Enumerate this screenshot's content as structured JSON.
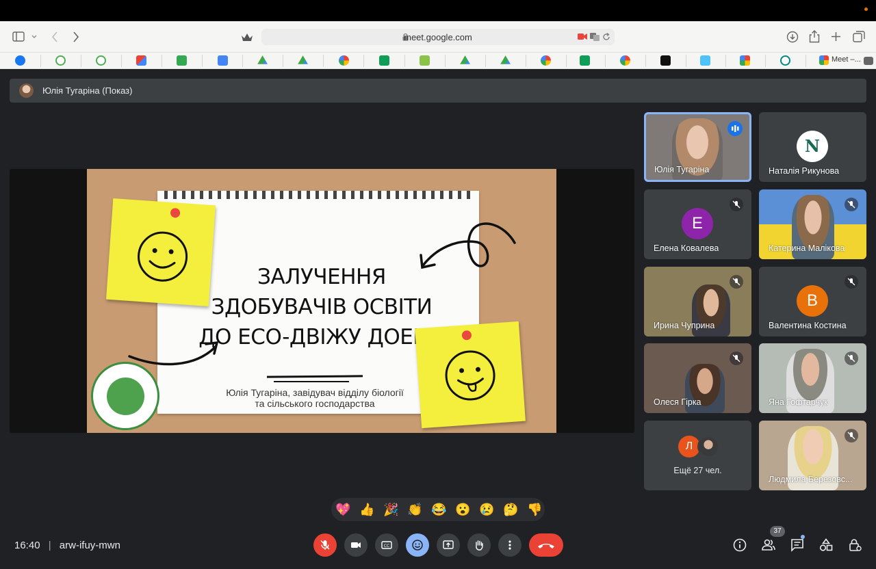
{
  "browser": {
    "url": "meet.google.com",
    "last_tab_label": "Meet –..."
  },
  "presenter_bar": {
    "label": "Юлія Тугаріна (Показ)"
  },
  "slide": {
    "title_lines": [
      "ЗАЛУЧЕННЯ",
      "ЗДОБУВАЧІВ ОСВІТИ",
      "ДО ECO-ДВІЖУ ДОЕНЦ"
    ],
    "subtitle_lines": [
      "Юлія Тугаріна, завідувач відділу біології",
      "та сільського господарства"
    ]
  },
  "participants": [
    {
      "name": "Юлія Тугаріна",
      "type": "video",
      "speaking": true
    },
    {
      "name": "Наталія Рикунова",
      "type": "logo",
      "initial": "N"
    },
    {
      "name": "Елена Ковалева",
      "type": "avatar",
      "initial": "E",
      "color": "#8e24aa",
      "muted": true
    },
    {
      "name": "Катерина Малікова",
      "type": "video",
      "muted": true
    },
    {
      "name": "Ирина Чуприна",
      "type": "video",
      "muted": true
    },
    {
      "name": "Валентина Костина",
      "type": "avatar",
      "initial": "B",
      "color": "#e8710a",
      "muted": true
    },
    {
      "name": "Олеся Гірка",
      "type": "video",
      "muted": true
    },
    {
      "name": "Яна Гофтарчук",
      "type": "video",
      "muted": true
    },
    {
      "name": "Людмила Березовс...",
      "type": "video",
      "muted": true
    }
  ],
  "more_tile": {
    "label": "Ещё 27 чел.",
    "initial": "Л"
  },
  "reactions": [
    "💖",
    "👍",
    "🎉",
    "👏",
    "😂",
    "😮",
    "😢",
    "🤔",
    "👎"
  ],
  "footer": {
    "time": "16:40",
    "separator": "|",
    "meeting_code": "arw-ifuy-mwn",
    "participant_count": "37"
  },
  "colors": {
    "background": "#202124",
    "tile": "#3c4043",
    "accent": "#1a73e8",
    "danger": "#ea4335",
    "sticky": "#f4ee3c"
  }
}
